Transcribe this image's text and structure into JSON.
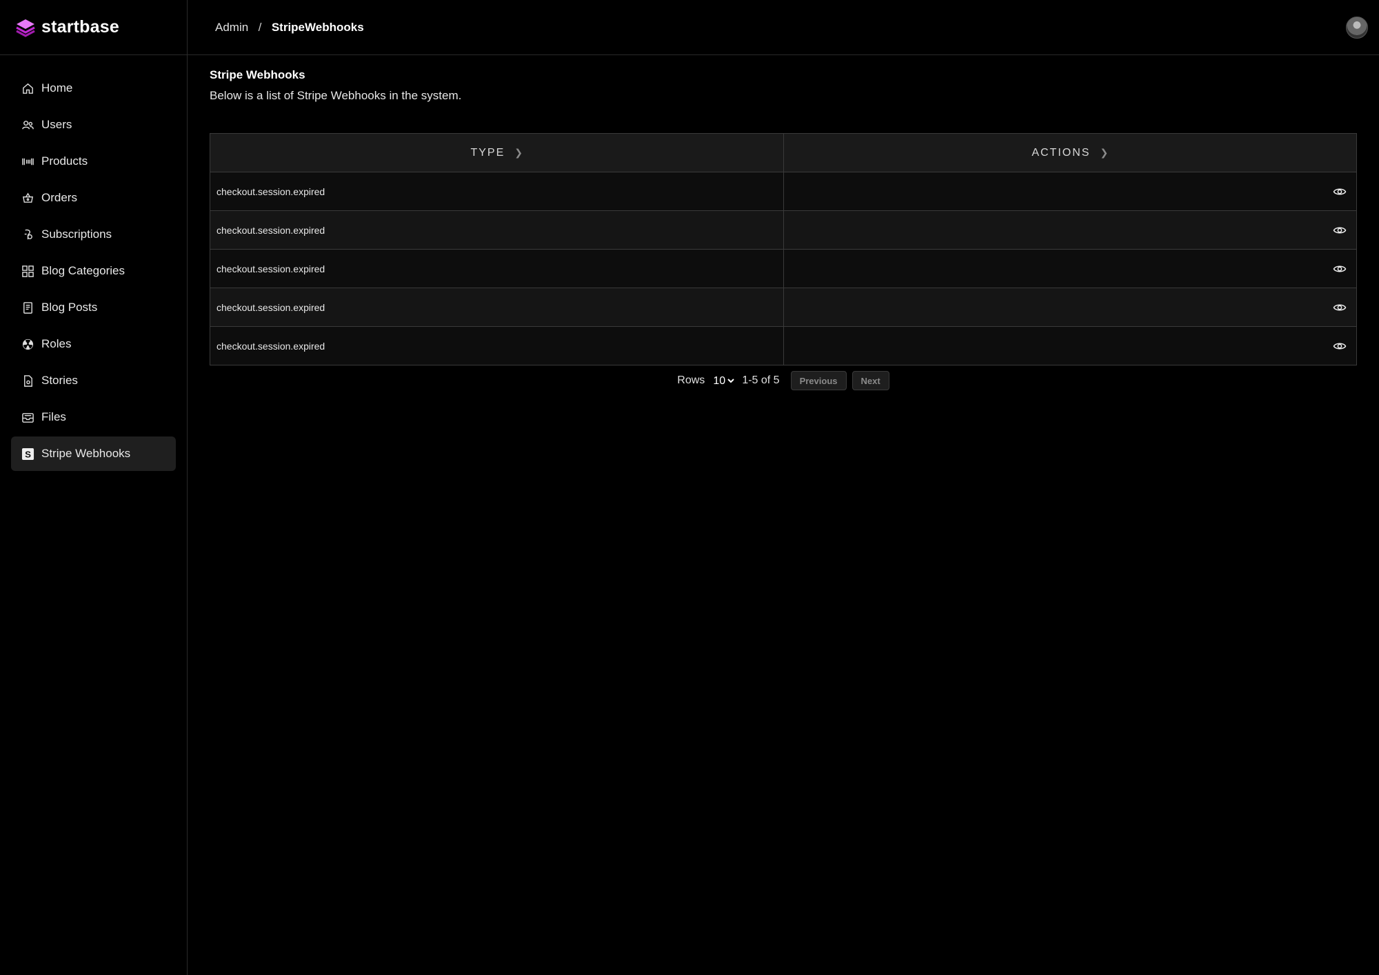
{
  "brand": {
    "name": "startbase",
    "accent": "#d946ef"
  },
  "sidebar": {
    "items": [
      {
        "label": "Home",
        "icon": "home-icon"
      },
      {
        "label": "Users",
        "icon": "users-icon"
      },
      {
        "label": "Products",
        "icon": "barcode-icon"
      },
      {
        "label": "Orders",
        "icon": "basket-icon"
      },
      {
        "label": "Subscriptions",
        "icon": "subscriptions-icon"
      },
      {
        "label": "Blog Categories",
        "icon": "grid-icon"
      },
      {
        "label": "Blog Posts",
        "icon": "document-icon"
      },
      {
        "label": "Roles",
        "icon": "roles-icon"
      },
      {
        "label": "Stories",
        "icon": "file-icon"
      },
      {
        "label": "Files",
        "icon": "inbox-icon"
      },
      {
        "label": "Stripe Webhooks",
        "icon": "stripe-icon",
        "active": true
      }
    ]
  },
  "breadcrumb": {
    "parent": "Admin",
    "separator": "/",
    "current": "StripeWebhooks"
  },
  "page": {
    "title": "Stripe Webhooks",
    "description": "Below is a list of Stripe Webhooks in the system."
  },
  "table": {
    "columns": [
      "TYPE",
      "ACTIONS"
    ],
    "rows": [
      {
        "type": "checkout.session.expired"
      },
      {
        "type": "checkout.session.expired"
      },
      {
        "type": "checkout.session.expired"
      },
      {
        "type": "checkout.session.expired"
      },
      {
        "type": "checkout.session.expired"
      }
    ]
  },
  "pagination": {
    "rows_label": "Rows",
    "rows_per_page": "10",
    "range": "1-5 of 5",
    "previous": "Previous",
    "next": "Next"
  }
}
